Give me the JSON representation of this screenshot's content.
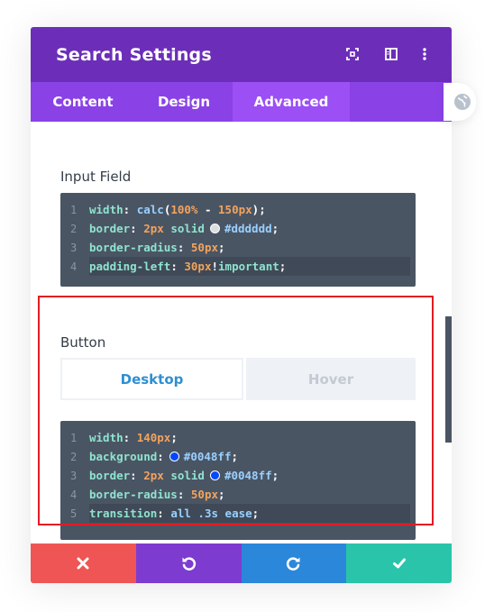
{
  "header": {
    "title": "Search Settings",
    "icons": [
      "expand-icon",
      "sidebar-icon",
      "more-icon"
    ]
  },
  "tabs": [
    {
      "label": "Content",
      "active": false
    },
    {
      "label": "Design",
      "active": false
    },
    {
      "label": "Advanced",
      "active": true
    }
  ],
  "input_field": {
    "label": "Input Field",
    "lines": [
      {
        "n": "1",
        "prop": "width",
        "parts": [
          {
            "t": "punc",
            "v": ": "
          },
          {
            "t": "val",
            "v": "calc"
          },
          {
            "t": "punc",
            "v": "("
          },
          {
            "t": "num",
            "v": "100%"
          },
          {
            "t": "punc",
            "v": " - "
          },
          {
            "t": "num",
            "v": "150px"
          },
          {
            "t": "punc",
            "v": ");"
          }
        ]
      },
      {
        "n": "2",
        "prop": "border",
        "parts": [
          {
            "t": "punc",
            "v": ": "
          },
          {
            "t": "num",
            "v": "2px"
          },
          {
            "t": "kw",
            "v": " solid"
          },
          {
            "t": "swatch",
            "v": "#dddddd"
          },
          {
            "t": "val",
            "v": "#dddddd"
          },
          {
            "t": "punc",
            "v": ";"
          }
        ]
      },
      {
        "n": "3",
        "prop": "border-radius",
        "parts": [
          {
            "t": "punc",
            "v": ": "
          },
          {
            "t": "num",
            "v": "50px"
          },
          {
            "t": "punc",
            "v": ";"
          }
        ]
      },
      {
        "n": "4",
        "prop": "padding-left",
        "parts": [
          {
            "t": "punc",
            "v": ": "
          },
          {
            "t": "num",
            "v": "30px"
          },
          {
            "t": "punc",
            "v": "!"
          },
          {
            "t": "kw",
            "v": "important"
          },
          {
            "t": "punc",
            "v": ";"
          }
        ],
        "highlight": true
      }
    ]
  },
  "button": {
    "label": "Button",
    "toggle": {
      "desktop": "Desktop",
      "hover": "Hover",
      "active": "Desktop"
    },
    "lines": [
      {
        "n": "1",
        "prop": "width",
        "parts": [
          {
            "t": "punc",
            "v": ": "
          },
          {
            "t": "num",
            "v": "140px"
          },
          {
            "t": "punc",
            "v": ";"
          }
        ]
      },
      {
        "n": "2",
        "prop": "background",
        "parts": [
          {
            "t": "punc",
            "v": ":"
          },
          {
            "t": "swatch",
            "v": "#0048ff"
          },
          {
            "t": "val",
            "v": "#0048ff"
          },
          {
            "t": "punc",
            "v": ";"
          }
        ]
      },
      {
        "n": "3",
        "prop": "border",
        "parts": [
          {
            "t": "punc",
            "v": ": "
          },
          {
            "t": "num",
            "v": "2px"
          },
          {
            "t": "kw",
            "v": " solid"
          },
          {
            "t": "swatch",
            "v": "#0048ff"
          },
          {
            "t": "val",
            "v": "#0048ff"
          },
          {
            "t": "punc",
            "v": ";"
          }
        ]
      },
      {
        "n": "4",
        "prop": "border-radius",
        "parts": [
          {
            "t": "punc",
            "v": ": "
          },
          {
            "t": "num",
            "v": "50px"
          },
          {
            "t": "punc",
            "v": ";"
          }
        ]
      },
      {
        "n": "5",
        "prop": "transition",
        "parts": [
          {
            "t": "punc",
            "v": ": "
          },
          {
            "t": "val",
            "v": "all"
          },
          {
            "t": "val",
            "v": " .3s"
          },
          {
            "t": "val",
            "v": " ease"
          },
          {
            "t": "punc",
            "v": ";"
          }
        ],
        "highlight": true
      }
    ]
  },
  "footer": [
    {
      "name": "cancel-button",
      "icon": "close-icon",
      "color": "#ef5555"
    },
    {
      "name": "undo-button",
      "icon": "undo-icon",
      "color": "#7e3bd0"
    },
    {
      "name": "redo-button",
      "icon": "redo-icon",
      "color": "#2b87da"
    },
    {
      "name": "save-button",
      "icon": "check-icon",
      "color": "#29c4a9"
    }
  ],
  "colors": {
    "header": "#6c2eb9",
    "tabs": "#8a42e6",
    "code_bg": "#4a5564",
    "highlight_border": "#e31b23"
  }
}
